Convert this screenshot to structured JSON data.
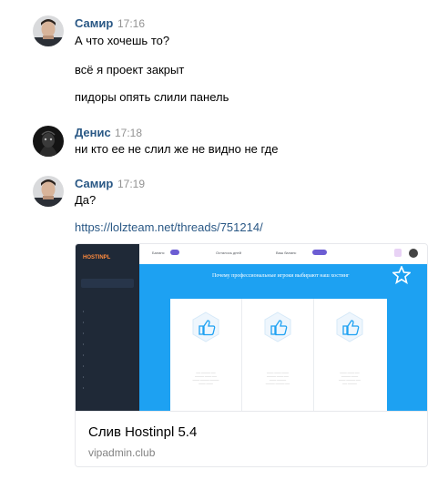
{
  "messages": [
    {
      "author": "Самир",
      "time": "17:16",
      "avatar": "samir-avatar",
      "lines": [
        "А что хочешь то?",
        "всё я проект закрыт",
        "пидоры опять слили панель"
      ]
    },
    {
      "author": "Денис",
      "time": "17:18",
      "avatar": "denis-avatar",
      "lines": [
        "ни кто ее не слил же не видно не где"
      ]
    },
    {
      "author": "Самир",
      "time": "17:19",
      "avatar": "samir-avatar",
      "lines": [
        "Да?"
      ],
      "link": "https://lolzteam.net/threads/751214/"
    }
  ],
  "attachment": {
    "title": "Слив Hostinpl 5.4",
    "domain": "vipadmin.club",
    "preview": {
      "logo": "HOSTINPL",
      "heading": "Почему профессиональные игроки выбирают наш хостинг",
      "topbar": [
        "Баланс",
        "Осталось дней",
        "Ваш баланс"
      ],
      "accent": "#1da1f2"
    }
  },
  "colors": {
    "author": "#2a5885",
    "time": "#939393",
    "link": "#2a5885"
  }
}
